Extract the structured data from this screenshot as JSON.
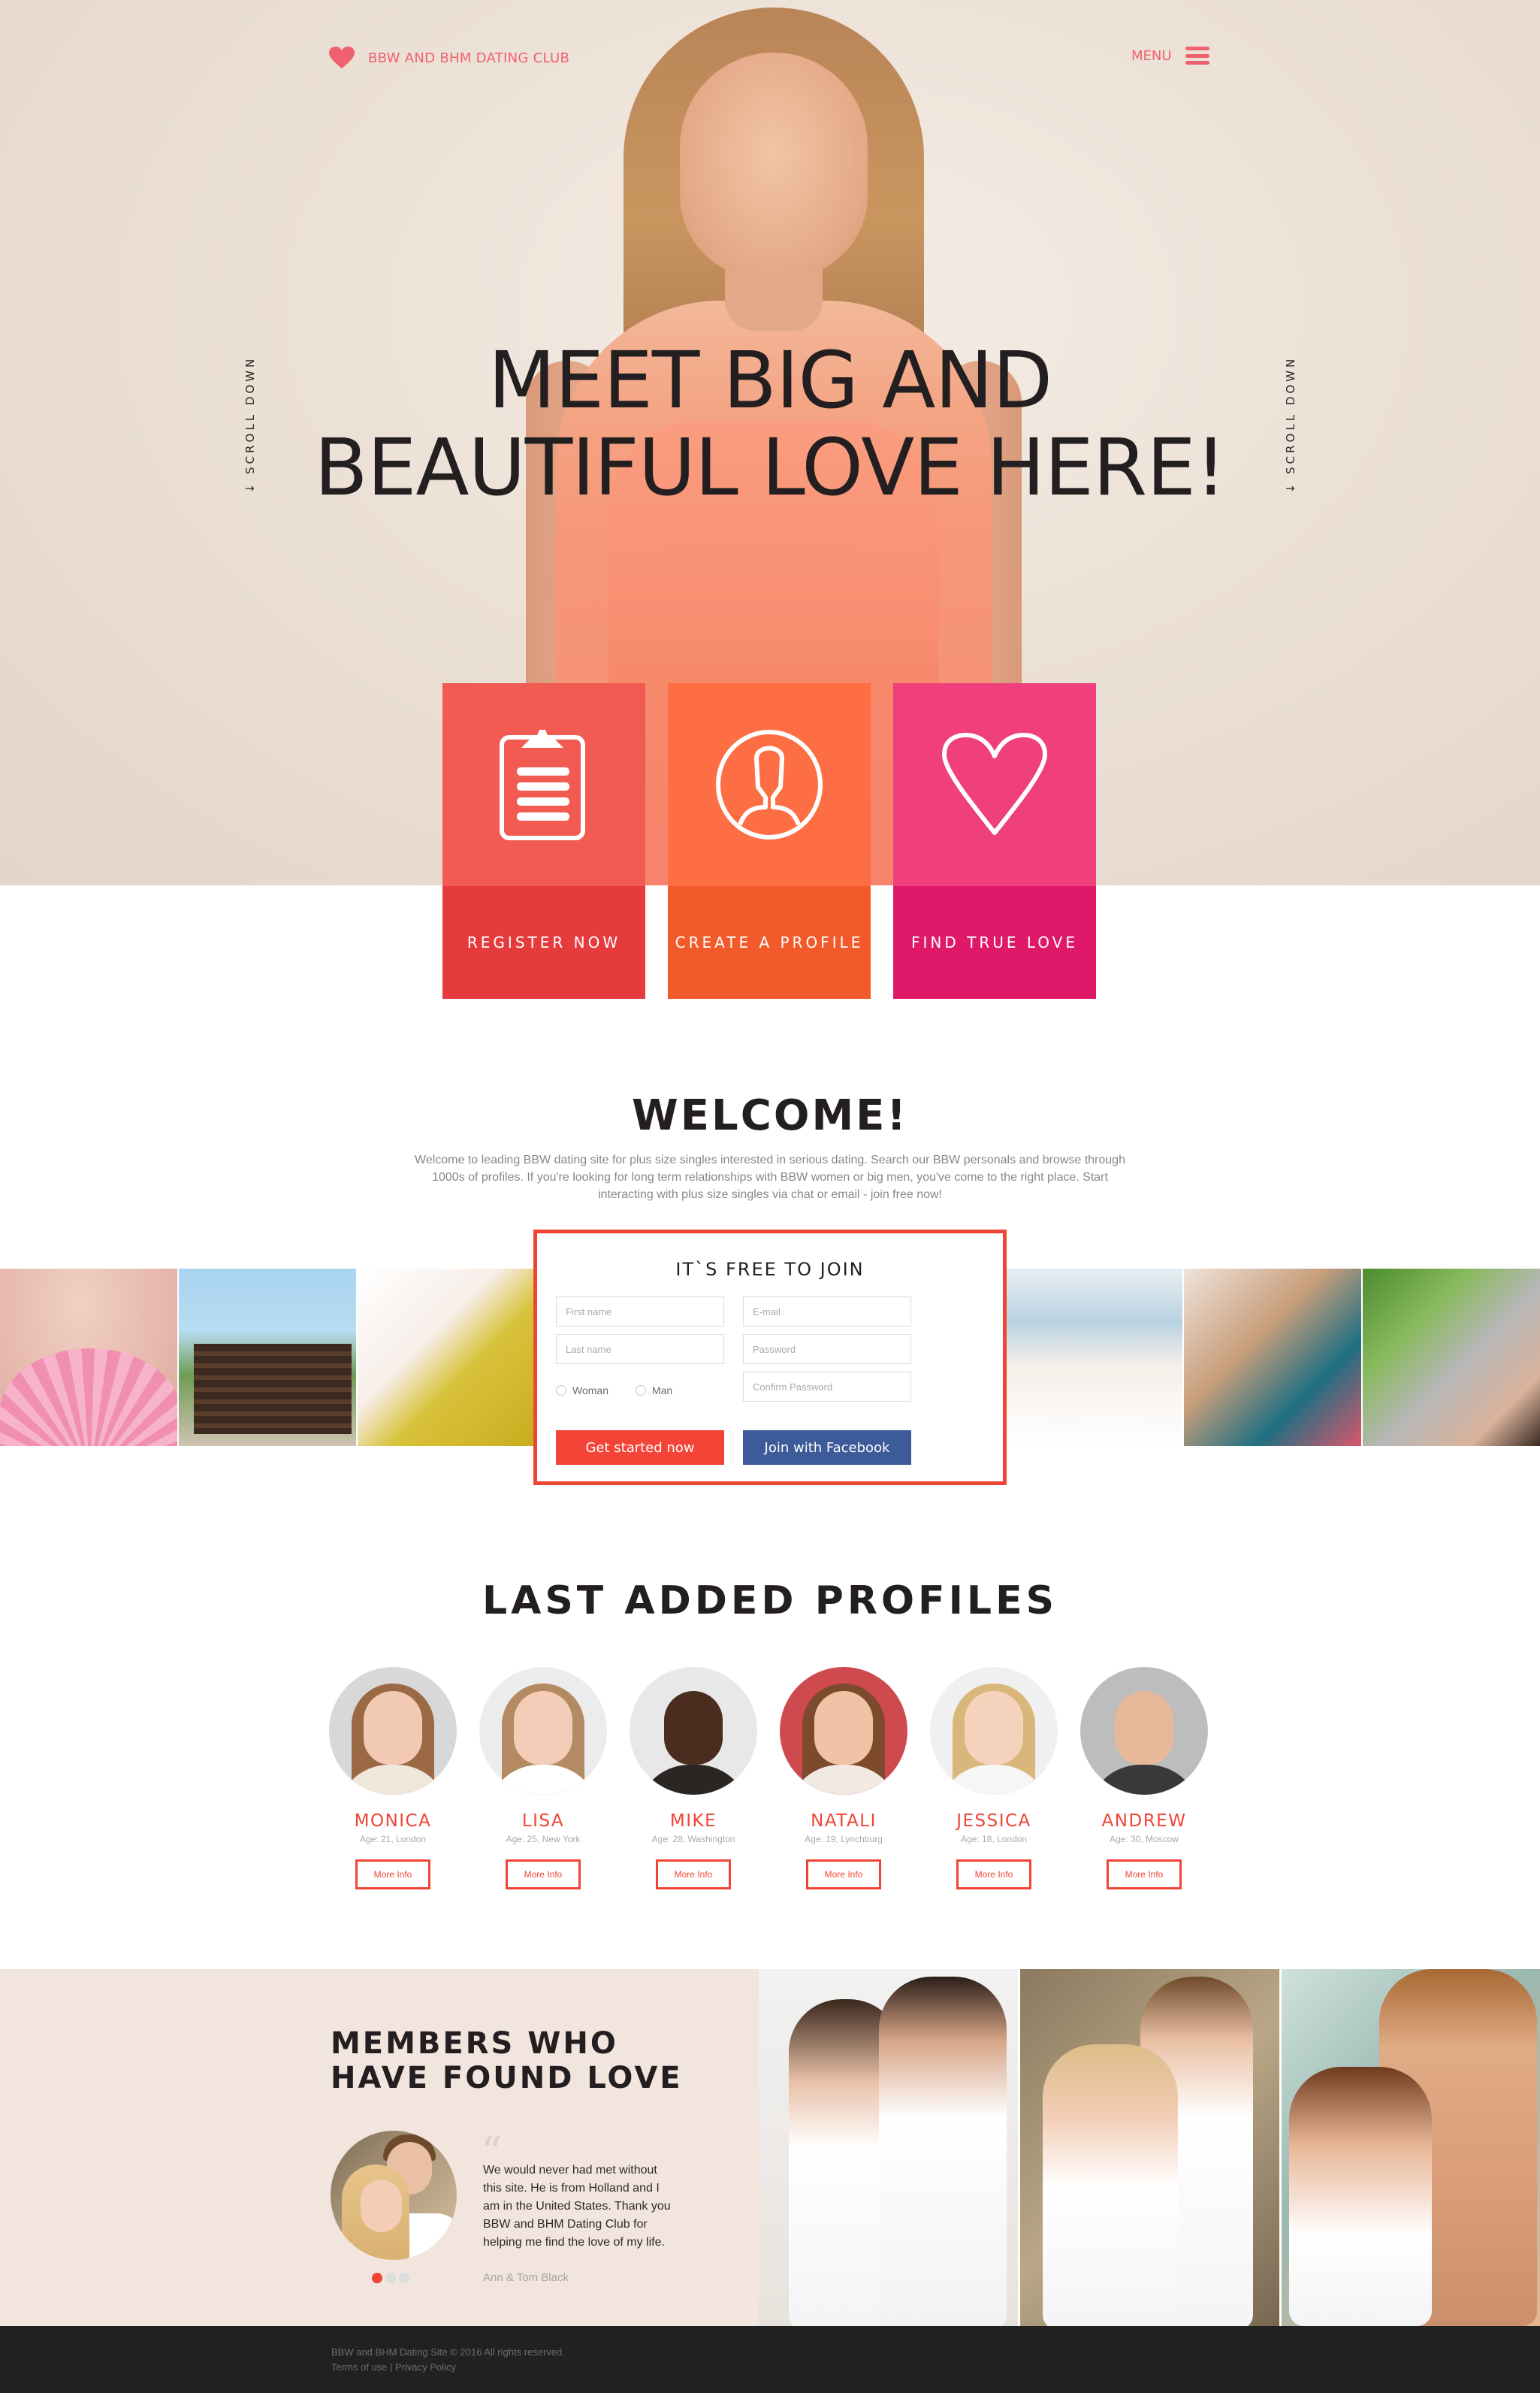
{
  "header": {
    "brand_name": "BBW AND BHM DATING CLUB",
    "menu_label": "MENU",
    "scroll_label": "↓  SCROLL DOWN"
  },
  "hero": {
    "title_line1": "MEET BIG AND",
    "title_line2": "BEAUTIFUL LOVE HERE!"
  },
  "features": [
    {
      "label": "REGISTER NOW",
      "icon": "clipboard-icon",
      "color_top": "#f25b52",
      "color_bottom": "#e63b3d"
    },
    {
      "label": "CREATE A PROFILE",
      "icon": "user-profile-icon",
      "color_top": "#fe6e44",
      "color_bottom": "#f35a2b"
    },
    {
      "label": "FIND TRUE LOVE",
      "icon": "heart-outline-icon",
      "color_top": "#ef3f7c",
      "color_bottom": "#e01869"
    }
  ],
  "welcome": {
    "title": "WELCOME!",
    "text": "Welcome to leading BBW dating site for plus size singles interested in serious dating. Search our BBW personals and browse through 1000s of profiles. If you're looking for long term relationships with BBW women or big men, you've come to the right place. Start interacting with plus size singles via chat or email - join free now!"
  },
  "join_form": {
    "title": "IT`S FREE TO JOIN",
    "first_name_placeholder": "First name",
    "last_name_placeholder": "Last name",
    "email_placeholder": "E-mail",
    "password_placeholder": "Password",
    "confirm_password_placeholder": "Confirm Password",
    "gender_options": [
      "Woman",
      "Man"
    ],
    "submit_label": "Get started now",
    "facebook_label": "Join with Facebook"
  },
  "profiles": {
    "title": "LAST ADDED PROFILES",
    "button_label": "More Info",
    "items": [
      {
        "name": "MONICA",
        "meta": "Age: 21, London"
      },
      {
        "name": "LISA",
        "meta": "Age: 25, New York"
      },
      {
        "name": "MIKE",
        "meta": "Age: 28, Washington"
      },
      {
        "name": "NATALI",
        "meta": "Age: 19, Lynchburg"
      },
      {
        "name": "JESSICA",
        "meta": "Age: 18, London"
      },
      {
        "name": "ANDREW",
        "meta": "Age: 30, Moscow"
      }
    ]
  },
  "testimonial": {
    "title_line1": "MEMBERS WHO",
    "title_line2": "HAVE FOUND LOVE",
    "quote_mark": "“",
    "quote": "We would never had met without this site. He is from Holland and I am in the United States. Thank you BBW and BHM Dating Club for helping me find the love of my life.",
    "author": "Ann & Tom Black",
    "slide_count": 3,
    "active_slide": 1
  },
  "footer": {
    "copyright": "BBW and BHM Dating Site © 2016 All rights reserved.",
    "terms_label": "Terms of use",
    "separator": "|",
    "privacy_label": "Privacy Policy"
  },
  "colors": {
    "accent": "#f04535",
    "brand_pink": "#f0616f",
    "facebook": "#3d5a99",
    "footer_bg": "#212121",
    "testimonial_bg": "#f1e5dd"
  }
}
